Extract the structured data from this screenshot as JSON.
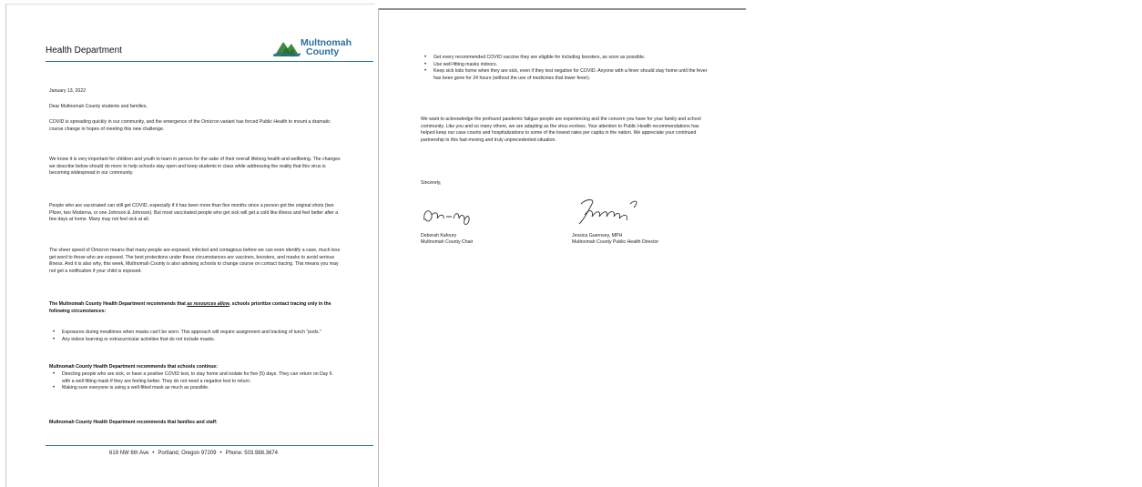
{
  "page1": {
    "department": "Health Department",
    "logo_line1": "Multnomah",
    "logo_line2": "County",
    "date": "January 13, 2022",
    "salutation": "Dear Multnomah County students and families,",
    "para1": "COVID is spreading quickly in our community, and the emergence of the Omicron variant has forced Public Health to mount a dramatic course change in hopes of meeting this new challenge.",
    "para2": "We know it is very important for children and youth to learn in person for the sake of their overall lifelong health and wellbeing. The changes we describe below should do more to help schools stay open and keep students in class while addressing the reality that this virus is becoming widespread in our community.",
    "para3": "People who are vaccinated can still get COVID, especially if it has been more than five months since a person got the original shots (two Pfizer, two Moderna, or one Johnson & Johnson). But most vaccinated people who get sick will get a cold like illness and feel better after a few days at home. Many may not feel sick at all.",
    "para4": "The sheer speed of Omicron means that many people are exposed, infected and contagious before we can even identify a case, much less get word to those who are exposed. The best protections under these circumstances are vaccines, boosters, and masks to avoid serious illness. And it is also why, this week, Multnomah County is also advising schools to change course on contact tracing. This means you may not get a notification if your child is exposed.",
    "rec1_pre": "The Multnomah County Health Department recommends that ",
    "rec1_emph": "as resources allow",
    "rec1_post": ", schools prioritize contact tracing only in the following circumstances:",
    "rec1_items": [
      "Exposures during mealtimes when masks can't be worn. This approach will require assignment and tracking of lunch \"pods.\"",
      "Any indoor learning or extracurricular activities that do not include masks."
    ],
    "rec2_heading": "Multnomah County Health Department recommends that schools continue:",
    "rec2_items": [
      "Directing people who are sick, or have a positive COVID test, to stay home and isolate for five (5) days. They can return on Day 6 with a well fitting mask if they are feeling better. They do not need a negative test to return.",
      "Making sure everyone is using a well-fitted mask as much as possible."
    ],
    "rec3_heading": "Multnomah County Health Department recommends that families and staff:",
    "footer_address": "619 NW 6th Ave",
    "footer_city": "Portland, Oregon 97209",
    "footer_phone": "Phone: 503.988.3674",
    "footer_sep": "•"
  },
  "page2": {
    "items": [
      "Get every recommended COVID vaccine they are eligible for including boosters, as soon as possible.",
      "Use well-fitting masks indoors.",
      "Keep sick kids home when they are sick, even if they test negative for COVID. Anyone with a fever should stay home until the fever has been gone for 24 hours (without the use of medicines that lower fever)."
    ],
    "closing_para": "We want to acknowledge the profound pandemic fatigue people are experiencing and the concern you have for your family and school community. Like you and so many others, we are adapting as the virus evolves. Your attention to Public Health recommendations has helped keep our case counts and hospitalizations to some of the lowest rates per capita in the nation. We appreciate your continued partnership in this fast-moving and truly unprecedented situation.",
    "sincerely": "Sincerely,",
    "sig1_name": "Deborah Kafoury",
    "sig1_title": "Multnomah County Chair",
    "sig2_name": "Jessica Guernsey, MPH",
    "sig2_title": "Multnomah County Public Health Director"
  },
  "colors": {
    "brand_blue": "#2b6f9e",
    "brand_green": "#3c8a3f"
  },
  "icons": {
    "logo": "multnomah-mountain-logo-icon"
  }
}
